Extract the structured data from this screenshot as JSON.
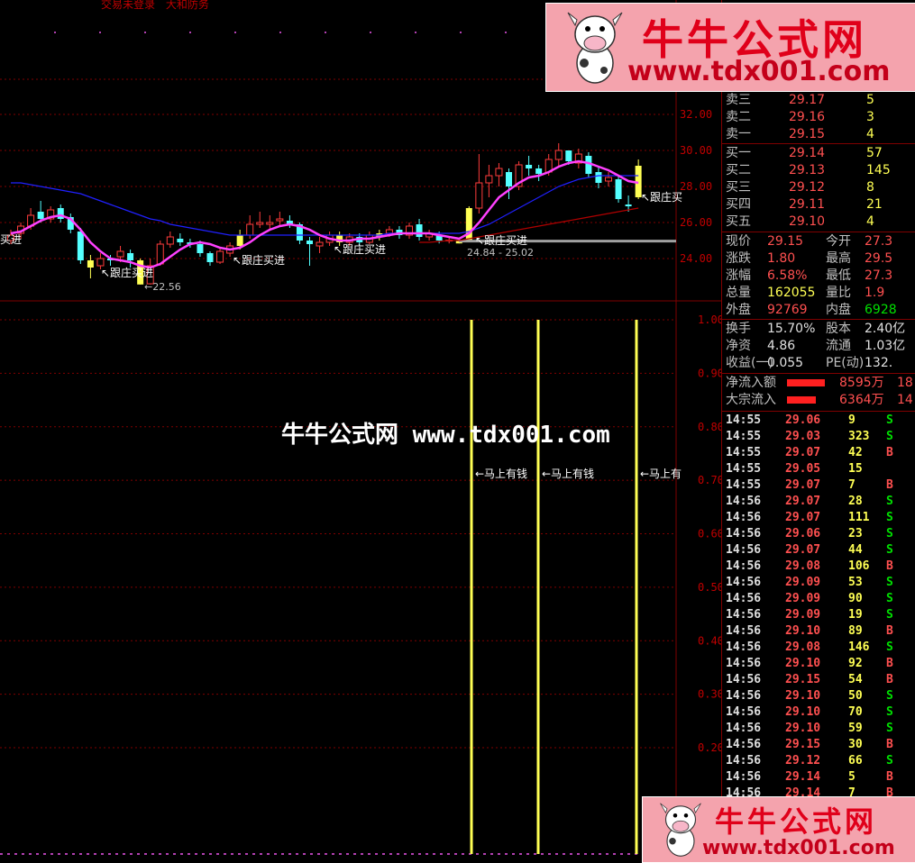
{
  "top_menu": {
    "item1": "交易未登录",
    "item2": "大和防务"
  },
  "watermark": "牛牛公式网 www.tdx001.com",
  "banner": {
    "title": "牛牛公式网",
    "url": "www.tdx001.com"
  },
  "price_axis": [
    "32.00",
    "30.00",
    "28.00",
    "26.00",
    "24.00"
  ],
  "indicator_axis": [
    "1.00",
    "0.90",
    "0.80",
    "0.70",
    "0.60",
    "0.50",
    "0.40",
    "0.30",
    "0.20"
  ],
  "annotations": {
    "follow_buy": "跟庄买进",
    "follow_buy_partial": "买进",
    "follow_buy_edge": "跟庄买",
    "low_price": "22.56",
    "range": "24.84 - 25.02",
    "money_signal": "←马上有钱",
    "money_signal_edge": "←马上有"
  },
  "chart_data": {
    "type": "candlestick",
    "title": "",
    "ylabel": "",
    "ylim": [
      22,
      33
    ],
    "y2lim": [
      0.1,
      1.05
    ],
    "candles": [
      {
        "o": 25.0,
        "c": 25.3,
        "h": 25.6,
        "l": 24.8
      },
      {
        "o": 25.4,
        "c": 25.8,
        "h": 26.0,
        "l": 25.1
      },
      {
        "o": 25.8,
        "c": 26.4,
        "h": 26.8,
        "l": 25.6
      },
      {
        "o": 26.6,
        "c": 26.2,
        "h": 27.2,
        "l": 26.0
      },
      {
        "o": 26.2,
        "c": 26.7,
        "h": 26.9,
        "l": 26.0
      },
      {
        "o": 26.8,
        "c": 26.2,
        "h": 27.0,
        "l": 26.0
      },
      {
        "o": 26.3,
        "c": 25.6,
        "h": 26.5,
        "l": 25.4
      },
      {
        "o": 25.5,
        "c": 23.9,
        "h": 25.7,
        "l": 23.7
      },
      {
        "o": 23.9,
        "c": 23.5,
        "h": 24.2,
        "l": 22.9
      },
      {
        "o": 23.6,
        "c": 24.0,
        "h": 24.3,
        "l": 23.4
      },
      {
        "o": 24.0,
        "c": 23.9,
        "h": 24.2,
        "l": 23.6
      },
      {
        "o": 24.1,
        "c": 24.4,
        "h": 24.7,
        "l": 23.8
      },
      {
        "o": 24.3,
        "c": 23.9,
        "h": 24.5,
        "l": 23.5
      },
      {
        "o": 23.9,
        "c": 22.56,
        "h": 24.0,
        "l": 22.56
      },
      {
        "o": 22.6,
        "c": 23.6,
        "h": 24.0,
        "l": 22.56
      },
      {
        "o": 23.7,
        "c": 24.8,
        "h": 25.0,
        "l": 23.6
      },
      {
        "o": 24.8,
        "c": 25.2,
        "h": 25.5,
        "l": 24.6
      },
      {
        "o": 25.1,
        "c": 24.9,
        "h": 25.4,
        "l": 24.7
      },
      {
        "o": 24.9,
        "c": 24.8,
        "h": 25.1,
        "l": 24.6
      },
      {
        "o": 24.8,
        "c": 24.3,
        "h": 25.0,
        "l": 24.1
      },
      {
        "o": 24.3,
        "c": 23.8,
        "h": 24.4,
        "l": 23.6
      },
      {
        "o": 23.8,
        "c": 24.4,
        "h": 24.6,
        "l": 23.7
      },
      {
        "o": 24.3,
        "c": 24.7,
        "h": 24.9,
        "l": 24.1
      },
      {
        "o": 24.7,
        "c": 25.3,
        "h": 25.6,
        "l": 24.5
      },
      {
        "o": 25.3,
        "c": 25.9,
        "h": 26.4,
        "l": 25.1
      },
      {
        "o": 25.9,
        "c": 26.0,
        "h": 26.6,
        "l": 25.7
      },
      {
        "o": 25.9,
        "c": 26.0,
        "h": 26.4,
        "l": 25.6
      },
      {
        "o": 26.1,
        "c": 26.2,
        "h": 26.6,
        "l": 25.8
      },
      {
        "o": 26.1,
        "c": 25.9,
        "h": 26.4,
        "l": 25.7
      },
      {
        "o": 25.9,
        "c": 25.0,
        "h": 26.0,
        "l": 24.8
      },
      {
        "o": 25.0,
        "c": 24.8,
        "h": 25.2,
        "l": 23.6
      },
      {
        "o": 24.7,
        "c": 24.9,
        "h": 25.2,
        "l": 24.3
      },
      {
        "o": 24.9,
        "c": 25.3,
        "h": 25.5,
        "l": 24.7
      },
      {
        "o": 25.3,
        "c": 24.9,
        "h": 25.5,
        "l": 24.7
      },
      {
        "o": 24.9,
        "c": 25.2,
        "h": 25.4,
        "l": 24.7
      },
      {
        "o": 25.2,
        "c": 24.9,
        "h": 25.4,
        "l": 24.7
      },
      {
        "o": 24.9,
        "c": 25.3,
        "h": 25.5,
        "l": 24.8
      },
      {
        "o": 25.2,
        "c": 25.4,
        "h": 25.6,
        "l": 25.0
      },
      {
        "o": 25.4,
        "c": 25.6,
        "h": 25.8,
        "l": 25.2
      },
      {
        "o": 25.6,
        "c": 25.3,
        "h": 25.8,
        "l": 25.1
      },
      {
        "o": 25.3,
        "c": 25.8,
        "h": 26.0,
        "l": 25.1
      },
      {
        "o": 25.9,
        "c": 25.2,
        "h": 26.2,
        "l": 25.0
      },
      {
        "o": 25.2,
        "c": 25.4,
        "h": 25.6,
        "l": 25.0
      },
      {
        "o": 25.3,
        "c": 25.0,
        "h": 25.5,
        "l": 24.84
      },
      {
        "o": 25.0,
        "c": 25.02,
        "h": 25.2,
        "l": 24.84
      },
      {
        "o": 24.84,
        "c": 25.02,
        "h": 25.1,
        "l": 24.84
      },
      {
        "o": 25.0,
        "c": 26.8,
        "h": 26.9,
        "l": 24.9
      },
      {
        "o": 26.8,
        "c": 28.2,
        "h": 29.8,
        "l": 26.5
      },
      {
        "o": 28.2,
        "c": 28.6,
        "h": 29.2,
        "l": 27.4
      },
      {
        "o": 28.6,
        "c": 29.0,
        "h": 29.3,
        "l": 28.0
      },
      {
        "o": 28.8,
        "c": 28.0,
        "h": 29.0,
        "l": 27.3
      },
      {
        "o": 28.0,
        "c": 29.2,
        "h": 29.4,
        "l": 27.8
      },
      {
        "o": 29.2,
        "c": 29.0,
        "h": 29.7,
        "l": 28.6
      },
      {
        "o": 29.0,
        "c": 28.7,
        "h": 29.2,
        "l": 28.3
      },
      {
        "o": 28.8,
        "c": 29.5,
        "h": 29.8,
        "l": 28.6
      },
      {
        "o": 29.5,
        "c": 30.0,
        "h": 30.4,
        "l": 29.1
      },
      {
        "o": 30.0,
        "c": 29.4,
        "h": 30.0,
        "l": 29.2
      },
      {
        "o": 29.3,
        "c": 29.8,
        "h": 30.1,
        "l": 29.0
      },
      {
        "o": 29.7,
        "c": 28.7,
        "h": 29.9,
        "l": 28.5
      },
      {
        "o": 28.8,
        "c": 28.2,
        "h": 29.1,
        "l": 27.9
      },
      {
        "o": 28.3,
        "c": 28.5,
        "h": 28.8,
        "l": 28.0
      },
      {
        "o": 28.4,
        "c": 27.3,
        "h": 28.6,
        "l": 27.1
      },
      {
        "o": 27.0,
        "c": 26.9,
        "h": 27.5,
        "l": 26.6
      },
      {
        "o": 27.4,
        "c": 29.15,
        "h": 29.5,
        "l": 27.3
      }
    ],
    "ma_fast": [
      25.4,
      25.5,
      25.8,
      26.1,
      26.3,
      26.4,
      26.2,
      25.6,
      24.9,
      24.4,
      24.0,
      23.9,
      23.8,
      23.6,
      23.5,
      23.7,
      24.1,
      24.5,
      24.8,
      24.9,
      24.8,
      24.6,
      24.5,
      24.6,
      24.9,
      25.3,
      25.6,
      25.8,
      25.9,
      25.8,
      25.6,
      25.3,
      25.1,
      25.0,
      25.0,
      25.1,
      25.1,
      25.2,
      25.3,
      25.4,
      25.4,
      25.4,
      25.4,
      25.3,
      25.2,
      25.1,
      25.4,
      26.0,
      26.7,
      27.4,
      27.8,
      28.2,
      28.5,
      28.6,
      28.8,
      29.1,
      29.3,
      29.4,
      29.3,
      29.1,
      28.9,
      28.6,
      28.3,
      28.2
    ],
    "ma_slow": [
      28.2,
      28.2,
      28.1,
      28.0,
      27.9,
      27.8,
      27.7,
      27.6,
      27.4,
      27.2,
      27.0,
      26.8,
      26.6,
      26.4,
      26.2,
      26.1,
      25.9,
      25.8,
      25.7,
      25.6,
      25.5,
      25.4,
      25.3,
      25.3,
      25.3,
      25.3,
      25.3,
      25.3,
      25.3,
      25.3,
      25.3,
      25.3,
      25.3,
      25.3,
      25.3,
      25.3,
      25.3,
      25.3,
      25.4,
      25.4,
      25.4,
      25.4,
      25.4,
      25.4,
      25.4,
      25.4,
      25.5,
      25.7,
      25.9,
      26.2,
      26.5,
      26.8,
      27.1,
      27.4,
      27.7,
      28.0,
      28.2,
      28.4,
      28.5,
      28.6,
      28.6,
      28.6,
      28.6,
      28.6
    ],
    "ma_long": [
      null,
      null,
      null,
      null,
      null,
      null,
      null,
      null,
      null,
      null,
      null,
      null,
      null,
      null,
      null,
      null,
      null,
      null,
      null,
      null,
      null,
      null,
      null,
      null,
      null,
      null,
      null,
      null,
      null,
      null,
      null,
      null,
      null,
      null,
      null,
      null,
      null,
      null,
      null,
      null,
      null,
      24.9,
      24.9,
      24.95,
      25.0,
      25.0,
      25.1,
      25.2,
      25.3,
      25.4,
      25.5,
      25.6,
      25.7,
      25.8,
      25.9,
      26.0,
      26.1,
      26.2,
      26.3,
      26.4,
      26.5,
      26.6,
      26.7,
      26.8
    ],
    "reference_line": 25.02,
    "indicator_signals_at_candle": [
      46,
      54,
      63
    ],
    "indicator_signal_value": 1.0
  },
  "quote": {
    "asks": [
      {
        "label": "卖三",
        "price": "29.17",
        "vol": "5"
      },
      {
        "label": "卖二",
        "price": "29.16",
        "vol": "3"
      },
      {
        "label": "卖一",
        "price": "29.15",
        "vol": "4"
      }
    ],
    "bids": [
      {
        "label": "买一",
        "price": "29.14",
        "vol": "57"
      },
      {
        "label": "买二",
        "price": "29.13",
        "vol": "145"
      },
      {
        "label": "买三",
        "price": "29.12",
        "vol": "8"
      },
      {
        "label": "买四",
        "price": "29.11",
        "vol": "21"
      },
      {
        "label": "买五",
        "price": "29.10",
        "vol": "4"
      }
    ],
    "stats": [
      {
        "l1": "现价",
        "v1": "29.15",
        "l2": "今开",
        "v2": "27.3"
      },
      {
        "l1": "涨跌",
        "v1": "1.80",
        "l2": "最高",
        "v2": "29.5"
      },
      {
        "l1": "涨幅",
        "v1": "6.58%",
        "l2": "最低",
        "v2": "27.3"
      },
      {
        "l1": "总量",
        "v1": "162055",
        "l2": "量比",
        "v2": "1.9"
      },
      {
        "l1": "外盘",
        "v1": "92769",
        "l2": "内盘",
        "v2": "6928"
      }
    ],
    "stats2": [
      {
        "l1": "换手",
        "v1": "15.70%",
        "l2": "股本",
        "v2": "2.40亿"
      },
      {
        "l1": "净资",
        "v1": "4.86",
        "l2": "流通",
        "v2": "1.03亿"
      },
      {
        "l1": "收益(一)",
        "v1": "0.055",
        "l2": "PE(动)",
        "v2": "132."
      }
    ],
    "flows": [
      {
        "label": "净流入额",
        "value": "8595万",
        "extra": "18"
      },
      {
        "label": "大宗流入",
        "value": "6364万",
        "extra": "14"
      }
    ]
  },
  "ticks": [
    {
      "t": "14:55",
      "p": "29.06",
      "v": "9",
      "s": "S"
    },
    {
      "t": "14:55",
      "p": "29.03",
      "v": "323",
      "s": "S"
    },
    {
      "t": "14:55",
      "p": "29.07",
      "v": "42",
      "s": "B"
    },
    {
      "t": "14:55",
      "p": "29.05",
      "v": "15",
      "s": ""
    },
    {
      "t": "14:55",
      "p": "29.07",
      "v": "7",
      "s": "B"
    },
    {
      "t": "14:56",
      "p": "29.07",
      "v": "28",
      "s": "S"
    },
    {
      "t": "14:56",
      "p": "29.07",
      "v": "111",
      "s": "S"
    },
    {
      "t": "14:56",
      "p": "29.06",
      "v": "23",
      "s": "S"
    },
    {
      "t": "14:56",
      "p": "29.07",
      "v": "44",
      "s": "S"
    },
    {
      "t": "14:56",
      "p": "29.08",
      "v": "106",
      "s": "B"
    },
    {
      "t": "14:56",
      "p": "29.09",
      "v": "53",
      "s": "S"
    },
    {
      "t": "14:56",
      "p": "29.09",
      "v": "90",
      "s": "S"
    },
    {
      "t": "14:56",
      "p": "29.09",
      "v": "19",
      "s": "S"
    },
    {
      "t": "14:56",
      "p": "29.10",
      "v": "89",
      "s": "B"
    },
    {
      "t": "14:56",
      "p": "29.08",
      "v": "146",
      "s": "S"
    },
    {
      "t": "14:56",
      "p": "29.10",
      "v": "92",
      "s": "B"
    },
    {
      "t": "14:56",
      "p": "29.15",
      "v": "54",
      "s": "B"
    },
    {
      "t": "14:56",
      "p": "29.10",
      "v": "50",
      "s": "S"
    },
    {
      "t": "14:56",
      "p": "29.10",
      "v": "70",
      "s": "S"
    },
    {
      "t": "14:56",
      "p": "29.10",
      "v": "59",
      "s": "S"
    },
    {
      "t": "14:56",
      "p": "29.15",
      "v": "30",
      "s": "B"
    },
    {
      "t": "14:56",
      "p": "29.12",
      "v": "66",
      "s": "S"
    },
    {
      "t": "14:56",
      "p": "29.14",
      "v": "5",
      "s": "B"
    },
    {
      "t": "14:56",
      "p": "29.14",
      "v": "7",
      "s": "B"
    }
  ],
  "colors": {
    "up": "#ff3c3c",
    "down": "#54ffff",
    "signal": "#ffff54",
    "ma_fast": "#ff40ff",
    "ma_slow": "#2020ff",
    "ma_long": "#b00000",
    "grid": "#800000"
  }
}
